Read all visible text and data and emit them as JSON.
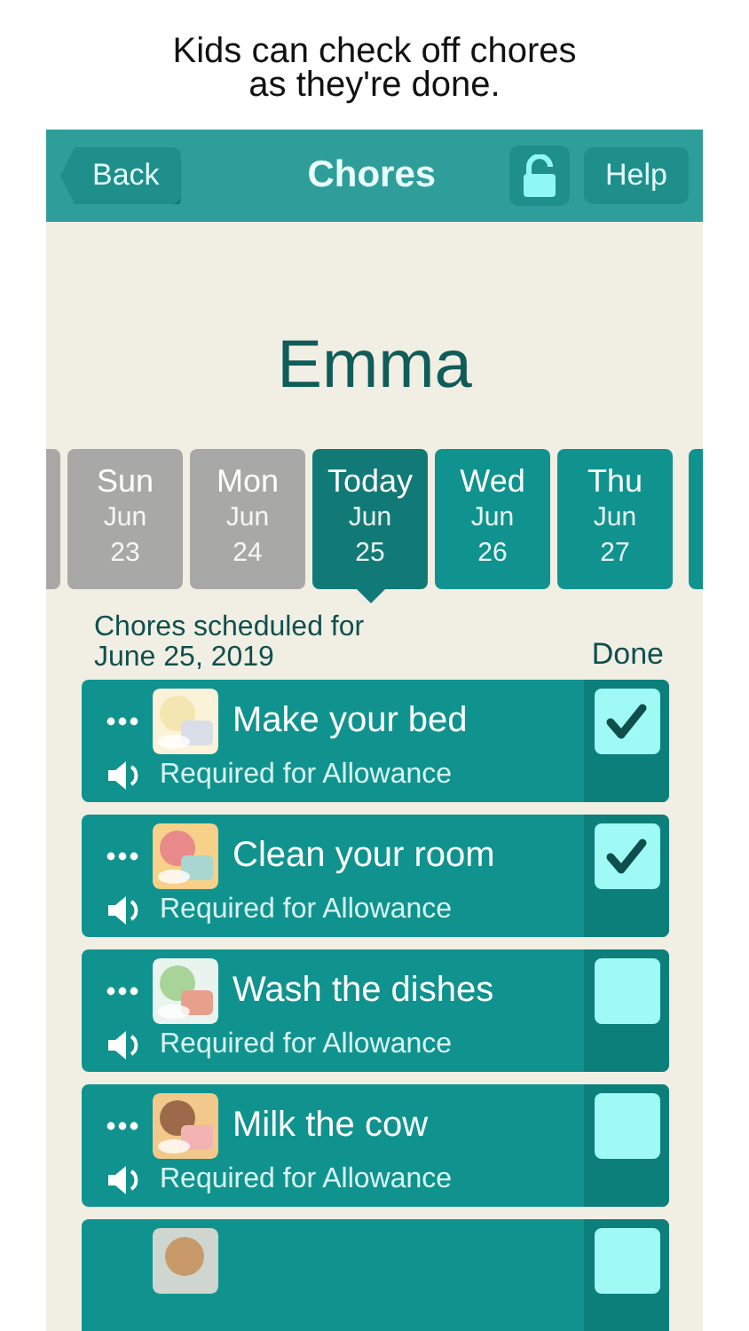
{
  "caption": "Kids can check off chores\nas they're done.",
  "header": {
    "back": "Back",
    "title": "Chores",
    "locked": false,
    "help": "Help"
  },
  "child_name": "Emma",
  "days": [
    {
      "day": "Sun",
      "month": "Jun",
      "date": "23",
      "past": true,
      "selected": false
    },
    {
      "day": "Mon",
      "month": "Jun",
      "date": "24",
      "past": true,
      "selected": false
    },
    {
      "day": "Today",
      "month": "Jun",
      "date": "25",
      "past": false,
      "selected": true
    },
    {
      "day": "Wed",
      "month": "Jun",
      "date": "26",
      "past": false,
      "selected": false
    },
    {
      "day": "Thu",
      "month": "Jun",
      "date": "27",
      "past": false,
      "selected": false
    }
  ],
  "list_heading": "Chores scheduled for\nJune 25, 2019",
  "done_heading": "Done",
  "chores": [
    {
      "name": "Make your bed",
      "note": "Required for Allowance",
      "checked": true
    },
    {
      "name": "Clean your room",
      "note": "Required for Allowance",
      "checked": true
    },
    {
      "name": "Wash the dishes",
      "note": "Required for Allowance",
      "checked": false
    },
    {
      "name": "Milk the cow",
      "note": "Required for Allowance",
      "checked": false
    }
  ],
  "partial_row": {
    "checked": false
  }
}
